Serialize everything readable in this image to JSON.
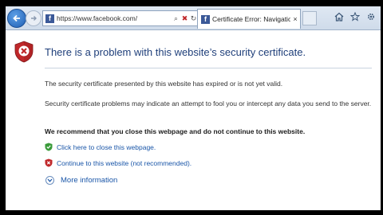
{
  "browser": {
    "address_url": "https://www.facebook.com/",
    "tab_title": "Certificate Error: Navigation...",
    "tab_close": "×",
    "favicon_letter": "f"
  },
  "page": {
    "title": "There is a problem with this website’s security certificate.",
    "para1": "The security certificate presented by this website has expired or is not yet valid.",
    "para2": "Security certificate problems may indicate an attempt to fool you or intercept any data you send to the server.",
    "recommend": "We recommend that you close this webpage and do not continue to this website.",
    "close_link": "Click here to close this webpage.",
    "continue_link": "Continue to this website (not recommended).",
    "more_info": "More information"
  },
  "icons": {
    "back": "back-arrow-icon",
    "forward": "forward-arrow-icon",
    "home": "home-icon",
    "favorites": "star-icon",
    "settings": "gear-icon",
    "shield": "error-shield-icon"
  },
  "colors": {
    "title": "#1f3f7a",
    "link": "#1a56a8",
    "shield_red": "#c0282a",
    "ok_green": "#3a9b3a"
  }
}
